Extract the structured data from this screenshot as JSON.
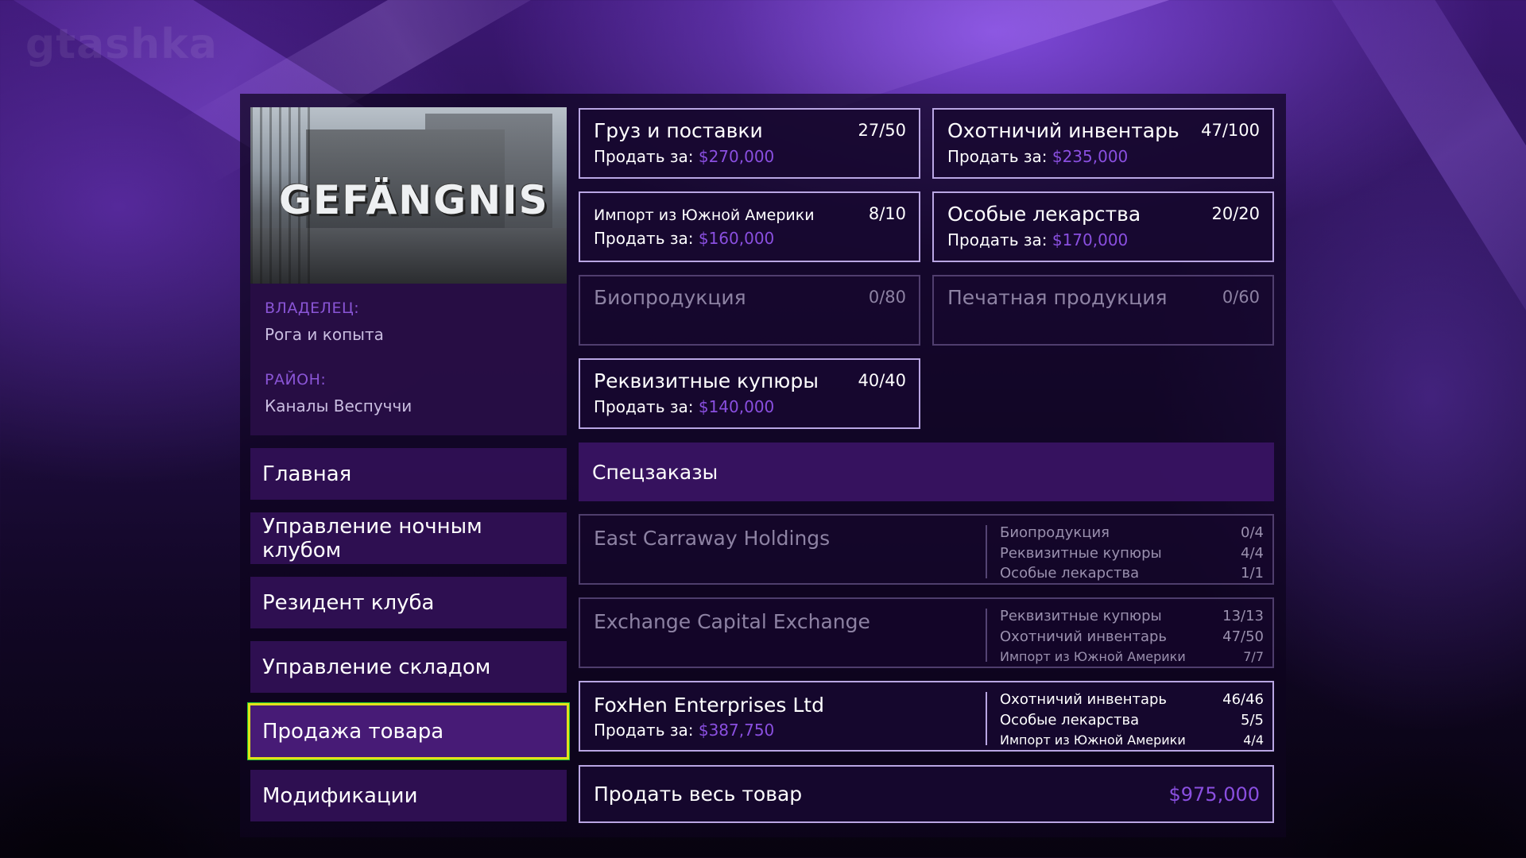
{
  "watermark": "gtashka",
  "business": {
    "image_logo": "GEFÄNGNIS",
    "owner_label": "ВЛАДЕЛЕЦ:",
    "owner_value": "Рога и копыта",
    "district_label": "РАЙОН:",
    "district_value": "Каналы Веспуччи"
  },
  "menu": {
    "items": [
      {
        "label": "Главная"
      },
      {
        "label": "Управление ночным клубом"
      },
      {
        "label": "Резидент клуба"
      },
      {
        "label": "Управление складом"
      },
      {
        "label": "Продажа товара",
        "active": true
      },
      {
        "label": "Модификации"
      }
    ]
  },
  "goods": {
    "sell_prefix": "Продать за:",
    "items": [
      {
        "title": "Груз и поставки",
        "count": "27/50",
        "price": "$270,000"
      },
      {
        "title": "Охотничий инвентарь",
        "count": "47/100",
        "price": "$235,000"
      },
      {
        "title": "Импорт из Южной Америки",
        "count": "8/10",
        "price": "$160,000"
      },
      {
        "title": "Особые лекарства",
        "count": "20/20",
        "price": "$170,000"
      },
      {
        "title": "Биопродукция",
        "count": "0/80",
        "price": ""
      },
      {
        "title": "Печатная продукция",
        "count": "0/60",
        "price": ""
      },
      {
        "title": "Реквизитные купюры",
        "count": "40/40",
        "price": "$140,000"
      }
    ]
  },
  "special_orders": {
    "header": "Спецзаказы",
    "orders": [
      {
        "name": "East Carraway Holdings",
        "price": "",
        "reqs": [
          {
            "item": "Биопродукция",
            "count": "0/4"
          },
          {
            "item": "Реквизитные купюры",
            "count": "4/4"
          },
          {
            "item": "Особые лекарства",
            "count": "1/1"
          }
        ]
      },
      {
        "name": "Exchange Capital Exchange",
        "price": "",
        "reqs": [
          {
            "item": "Реквизитные купюры",
            "count": "13/13"
          },
          {
            "item": "Охотничий инвентарь",
            "count": "47/50"
          },
          {
            "item": "Импорт из Южной Америки",
            "count": "7/7"
          }
        ]
      },
      {
        "name": "FoxHen Enterprises Ltd",
        "price": "$387,750",
        "reqs": [
          {
            "item": "Охотничий инвентарь",
            "count": "46/46"
          },
          {
            "item": "Особые лекарства",
            "count": "5/5"
          },
          {
            "item": "Импорт из Южной Америки",
            "count": "4/4"
          }
        ]
      }
    ]
  },
  "sell_all": {
    "label": "Продать весь товар",
    "total": "$975,000"
  },
  "colors": {
    "accent_price": "#8a4fe0",
    "label_purple": "#8a55d6",
    "card_border": "#b9a6e3",
    "active_outline": "#e2e21a",
    "active_outline_outer": "#22c832"
  }
}
